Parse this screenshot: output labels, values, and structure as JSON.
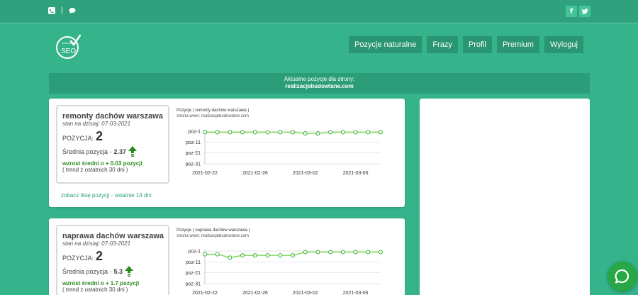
{
  "topbar": {
    "contact_icons": [
      "phone-icon",
      "chat-bubble-icon"
    ],
    "separator": "|",
    "social": [
      {
        "name": "facebook-icon",
        "label": "f"
      },
      {
        "name": "twitter-icon",
        "label": "t"
      }
    ]
  },
  "logo": {
    "text": "SEO",
    "small_text": "SPRAWDZ"
  },
  "nav": [
    "Pozycje naturalne",
    "Frazy",
    "Profil",
    "Premium",
    "Wyloguj"
  ],
  "banner": {
    "line1": "Aktualne pozycje dla strony:",
    "domain": "realizacjebudowlane.com"
  },
  "colors": {
    "background": "#35b38b",
    "line": "#7ed957",
    "trend": "#2a8a1e",
    "chat": "#27a745"
  },
  "cards": [
    {
      "keyword": "remonty dachów warszawa",
      "date_text": "stan na dzisiaj: 07-03-2021",
      "position_label": "POZYCJA:",
      "position": "2",
      "avg_label": "Średnia pozycja -",
      "avg_value": "2.37",
      "trend_text": "wzrost średni o + 0.03 pozycji",
      "trend_sub": "( trend z ostatnich 30 dni )",
      "link": "zobacz listę pozycji - ostatnie 14 dni",
      "chart_title": "Pozycje ( remonty dachów warszawa )",
      "chart_sub": "strona www: realizacjebudowlane.com"
    },
    {
      "keyword": "naprawa dachów warszawa",
      "date_text": "stan na dzisiaj: 07-03-2021",
      "position_label": "POZYCJA:",
      "position": "2",
      "avg_label": "Średnia pozycja -",
      "avg_value": "5.3",
      "trend_text": "wzrost średni o + 1.7 pozycji",
      "trend_sub": "( trend z ostatnich 30 dni )",
      "link": "",
      "chart_title": "Pozycje ( naprawa dachów warszawa )",
      "chart_sub": "strona www: realizacjebudowlane.com"
    }
  ],
  "chart_data": [
    {
      "type": "line",
      "title": "Pozycje ( remonty dachów warszawa )",
      "subtitle": "strona www: realizacjebudowlane.com",
      "ylabels": [
        "poz-1",
        "poz-11",
        "poz-21",
        "poz-31"
      ],
      "ylim": [
        1,
        31
      ],
      "inverted": true,
      "xticks": [
        "2021-02-22",
        "2021-02-26",
        "2021-03-02",
        "2021-03-06"
      ],
      "series": [
        {
          "values": [
            2,
            2,
            2,
            2,
            2,
            2,
            2,
            2,
            3,
            3,
            2,
            2,
            2,
            2,
            2
          ]
        }
      ]
    },
    {
      "type": "line",
      "title": "Pozycje ( naprawa dachów warszawa )",
      "subtitle": "strona www: realizacjebudowlane.com",
      "ylabels": [
        "poz-1",
        "poz-11",
        "poz-21",
        "poz-31"
      ],
      "ylim": [
        1,
        31
      ],
      "inverted": true,
      "xticks": [
        "2021-02-22",
        "2021-02-26",
        "2021-03-02",
        "2021-03-06"
      ],
      "series": [
        {
          "values": [
            4,
            4,
            7,
            5,
            5,
            5,
            5,
            5,
            2,
            2,
            2,
            2,
            2,
            2,
            2
          ]
        }
      ]
    }
  ]
}
